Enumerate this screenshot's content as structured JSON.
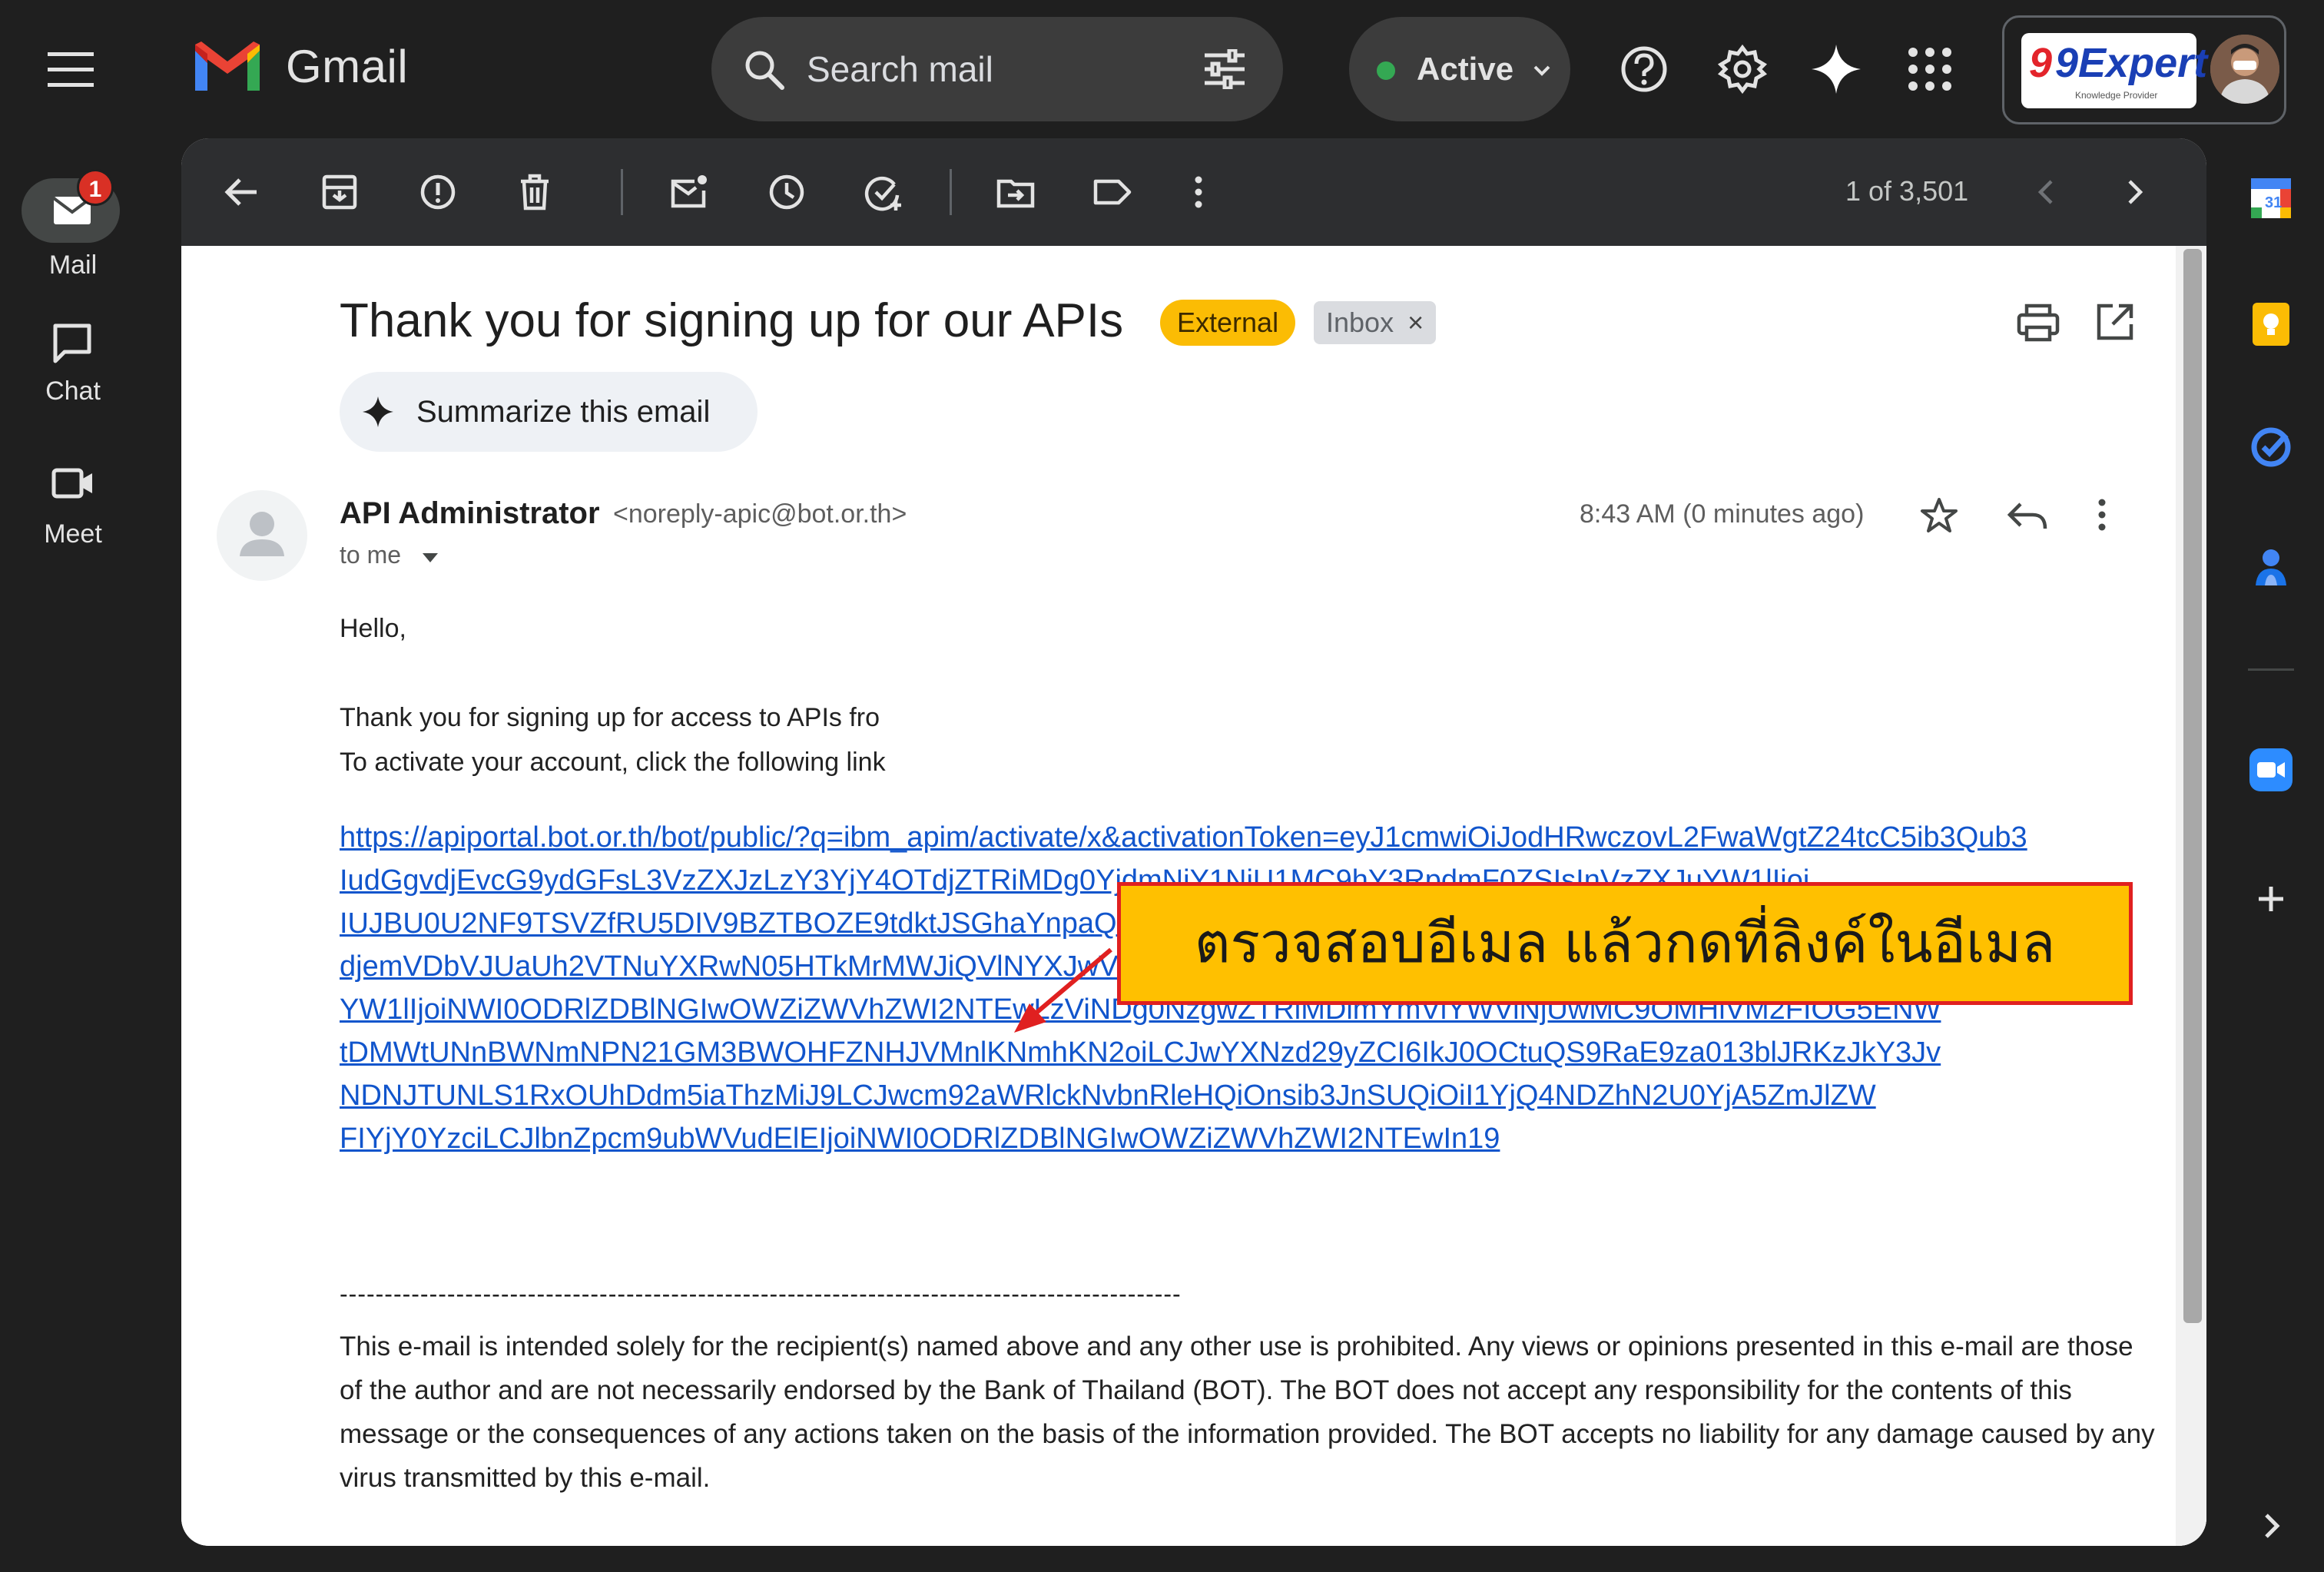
{
  "app": {
    "name": "Gmail"
  },
  "search": {
    "placeholder": "Search mail"
  },
  "status": {
    "label": "Active"
  },
  "brand": {
    "logo_text": "9Expert",
    "tagline": "Knowledge Provider"
  },
  "nav": {
    "items": [
      {
        "label": "Mail",
        "badge": "1"
      },
      {
        "label": "Chat"
      },
      {
        "label": "Meet"
      }
    ]
  },
  "pager": {
    "text": "1 of 3,501"
  },
  "email": {
    "subject": "Thank you for signing up for our APIs",
    "labels": {
      "external": "External",
      "inbox": "Inbox",
      "inbox_remove": "×"
    },
    "summarize_label": "Summarize this email",
    "sender": {
      "name": "API Administrator",
      "email": "<noreply-apic@bot.or.th>"
    },
    "to": "to me",
    "time": "8:43 AM (0 minutes ago)",
    "greeting": "Hello,",
    "line1": "Thank you for signing up for access to APIs fro",
    "line2": "To activate your account, click the following link",
    "link_lines": [
      "https://apiportal.bot.or.th/bot/public/?q=ibm_apim/activate/x&activationToken=eyJ1cmwiOiJodHRwczovL2FwaWgtZ24tcC5ib3Qub3",
      "IudGgvdjEvcG9ydGFsL3VzZXJzLzY3YjY4OTdjZTRiMDg0YjdmNjY1NjU1MC9hY3RpdmF0ZSIsInVzZXJuYW1lIjoi",
      "IUJBU0U2NF9TSVZfRU5DIV9BZTBOZE9tdktJSGhaYnpaQkcwQXM1aDc5enl2TUUzSHpHeS95QXBOWTF1ZkFBQUFGbF",
      "djemVDbVJUaUh2VTNuYXRwN05HTkMrMWJiQVlNYXJwVDNFU0VGVFZxNyIsImF1dGhlbnRpY2F0aW9uIjp7InVzZXJu",
      "YW1lIjoiNWI0ODRlZDBlNGIwOWZiZWVhZWI2NTEwLzViNDg0NzgwZTRiMDlmYmVlYWViNjUwMC9OMHlVM2FIOG5ENW",
      "tDMWtUNnBWNmNPN21GM3BWOHFZNHJVMnlKNmhKN2oiLCJwYXNzd29yZCI6IkJ0OCtuQS9RaE9za013blJRKzJkY3Jv",
      "NDNJTUNLS1RxOUhDdm5iaThzMiJ9LCJwcm92aWRlckNvbnRleHQiOnsib3JnSUQiOiI1YjQ4NDZhN2U0YjA5ZmJlZW",
      "FIYjY0YzciLCJlbnZpcm9ubWVudElEIjoiNWI0ODRlZDBlNGIwOWZiZWVhZWI2NTEwIn19"
    ],
    "divider": "----------------------------------------------------------------------------------------------",
    "disclaimer": "This e-mail is intended solely for the recipient(s) named above and any other use is prohibited. Any views or opinions presented in this e-mail are those of the author and are not necessarily endorsed by the Bank of Thailand (BOT). The BOT does not accept any responsibility for the contents of this message or the consequences of any actions taken on the basis of the information provided. The BOT accepts no liability for any damage caused by any virus transmitted by this e-mail."
  },
  "callout": {
    "text": "ตรวจสอบอีเมล แล้วกดที่ลิงค์ในอีเมล"
  },
  "colors": {
    "accent_link": "#1155cc",
    "external_tag": "#fbbc04",
    "callout_fill": "#ffc000",
    "callout_border": "#e02020",
    "active_dot": "#34a853",
    "badge": "#d93025"
  }
}
